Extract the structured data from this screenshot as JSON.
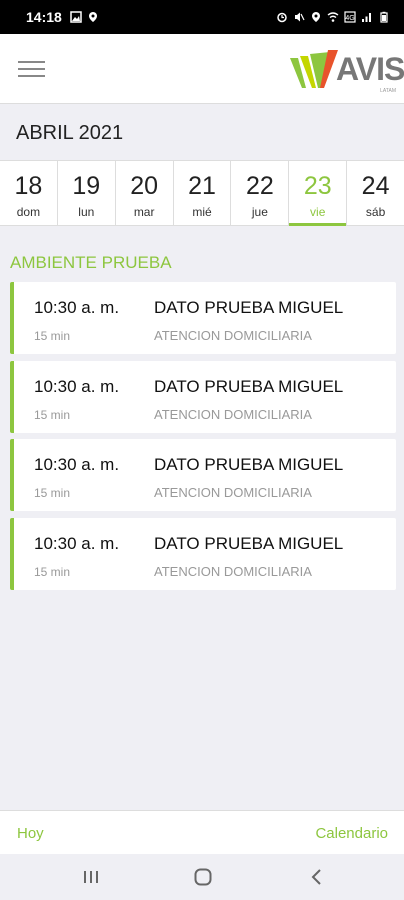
{
  "status_bar": {
    "time": "14:18",
    "icons": [
      "image-icon",
      "location-icon",
      "alarm-icon",
      "mute-icon",
      "location-icon",
      "wifi-icon",
      "data-icon",
      "signal-icon",
      "battery-icon"
    ]
  },
  "header": {
    "logo_text": "AVIS",
    "logo_sub": "LATAM",
    "brand_color": "#8dc63f"
  },
  "calendar": {
    "month": "ABRIL 2021",
    "days": [
      {
        "num": "18",
        "name": "dom"
      },
      {
        "num": "19",
        "name": "lun"
      },
      {
        "num": "20",
        "name": "mar"
      },
      {
        "num": "21",
        "name": "mié"
      },
      {
        "num": "22",
        "name": "jue"
      },
      {
        "num": "23",
        "name": "vie",
        "active": true
      },
      {
        "num": "24",
        "name": "sáb"
      }
    ]
  },
  "section": {
    "title": "AMBIENTE PRUEBA"
  },
  "appointments": [
    {
      "time": "10:30 a. m.",
      "duration": "15 min",
      "name": "DATO PRUEBA MIGUEL",
      "type": "ATENCION DOMICILIARIA"
    },
    {
      "time": "10:30 a. m.",
      "duration": "15 min",
      "name": "DATO PRUEBA MIGUEL",
      "type": "ATENCION DOMICILIARIA"
    },
    {
      "time": "10:30 a. m.",
      "duration": "15 min",
      "name": "DATO PRUEBA MIGUEL",
      "type": "ATENCION DOMICILIARIA"
    },
    {
      "time": "10:30 a. m.",
      "duration": "15 min",
      "name": "DATO PRUEBA MIGUEL",
      "type": "ATENCION DOMICILIARIA"
    }
  ],
  "bottom_bar": {
    "today_label": "Hoy",
    "calendar_label": "Calendario"
  }
}
